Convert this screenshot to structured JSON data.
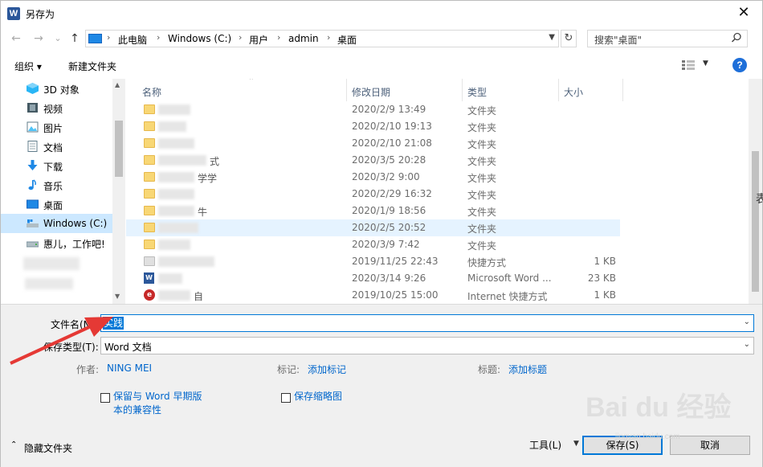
{
  "window": {
    "title": "另存为",
    "app_icon_letter": "W",
    "close_glyph": "✕"
  },
  "nav": {
    "back_glyph": "←",
    "forward_glyph": "→",
    "recent_glyph": "⌄",
    "up_glyph": "↑",
    "address": [
      "此电脑",
      "Windows (C:)",
      "用户",
      "admin",
      "桌面"
    ],
    "address_separator": "›",
    "refresh_glyph": "↻",
    "search_placeholder": "搜索\"桌面\""
  },
  "toolbar": {
    "organize_label": "组织 ▾",
    "new_folder_label": "新建文件夹",
    "help_glyph": "?"
  },
  "navpane": {
    "items": [
      {
        "label": "3D 对象"
      },
      {
        "label": "视频"
      },
      {
        "label": "图片"
      },
      {
        "label": "文档"
      },
      {
        "label": "下载"
      },
      {
        "label": "音乐"
      },
      {
        "label": "桌面"
      },
      {
        "label": "Windows (C:)",
        "selected": true
      },
      {
        "label": "惠儿，工作吧!"
      }
    ]
  },
  "filelist": {
    "columns": {
      "name": "名称",
      "date": "修改日期",
      "type": "类型",
      "size": "大小"
    },
    "rows": [
      {
        "icon": "folder",
        "date": "2020/2/9 13:49",
        "type": "文件夹",
        "size": "",
        "frag": ""
      },
      {
        "icon": "folder",
        "date": "2020/2/10 19:13",
        "type": "文件夹",
        "size": "",
        "frag": ""
      },
      {
        "icon": "folder",
        "date": "2020/2/10 21:08",
        "type": "文件夹",
        "size": "",
        "frag": ""
      },
      {
        "icon": "folder",
        "date": "2020/3/5 20:28",
        "type": "文件夹",
        "size": "",
        "frag": "式"
      },
      {
        "icon": "folder",
        "date": "2020/3/2 9:00",
        "type": "文件夹",
        "size": "",
        "frag": "学学"
      },
      {
        "icon": "folder",
        "date": "2020/2/29 16:32",
        "type": "文件夹",
        "size": "",
        "frag": ""
      },
      {
        "icon": "folder",
        "date": "2020/1/9 18:56",
        "type": "文件夹",
        "size": "",
        "frag": "牛"
      },
      {
        "icon": "folder",
        "date": "2020/2/5 20:52",
        "type": "文件夹",
        "size": "",
        "frag": "",
        "highlight": true
      },
      {
        "icon": "folder",
        "date": "2020/3/9 7:42",
        "type": "文件夹",
        "size": "",
        "frag": ""
      },
      {
        "icon": "shortcut",
        "date": "2019/11/25 22:43",
        "type": "快捷方式",
        "size": "1 KB",
        "frag": ""
      },
      {
        "icon": "word",
        "date": "2020/3/14 9:26",
        "type": "Microsoft Word ...",
        "size": "23 KB",
        "frag": ""
      },
      {
        "icon": "ie",
        "date": "2019/10/25 15:00",
        "type": "Internet 快捷方式",
        "size": "1 KB",
        "frag": "自"
      }
    ]
  },
  "save": {
    "filename_label": "文件名(N):",
    "filename_value": "实践",
    "filetype_label": "保存类型(T):",
    "filetype_value": "Word 文档",
    "author_label": "作者:",
    "author_value": "NING MEI",
    "tags_label": "标记:",
    "tags_link": "添加标记",
    "title_label": "标题:",
    "title_link": "添加标题",
    "compat_label_1": "保留与 Word 早期版",
    "compat_label_2": "本的兼容性",
    "thumb_label": "保存缩略图",
    "hide_folders": "隐藏文件夹",
    "tools": "工具(L)",
    "save_button": "保存(S)",
    "cancel_button": "取消"
  },
  "watermark": {
    "main": "Bai du 经验",
    "sub": "jingyan.baidu.com"
  },
  "background_text": "表"
}
